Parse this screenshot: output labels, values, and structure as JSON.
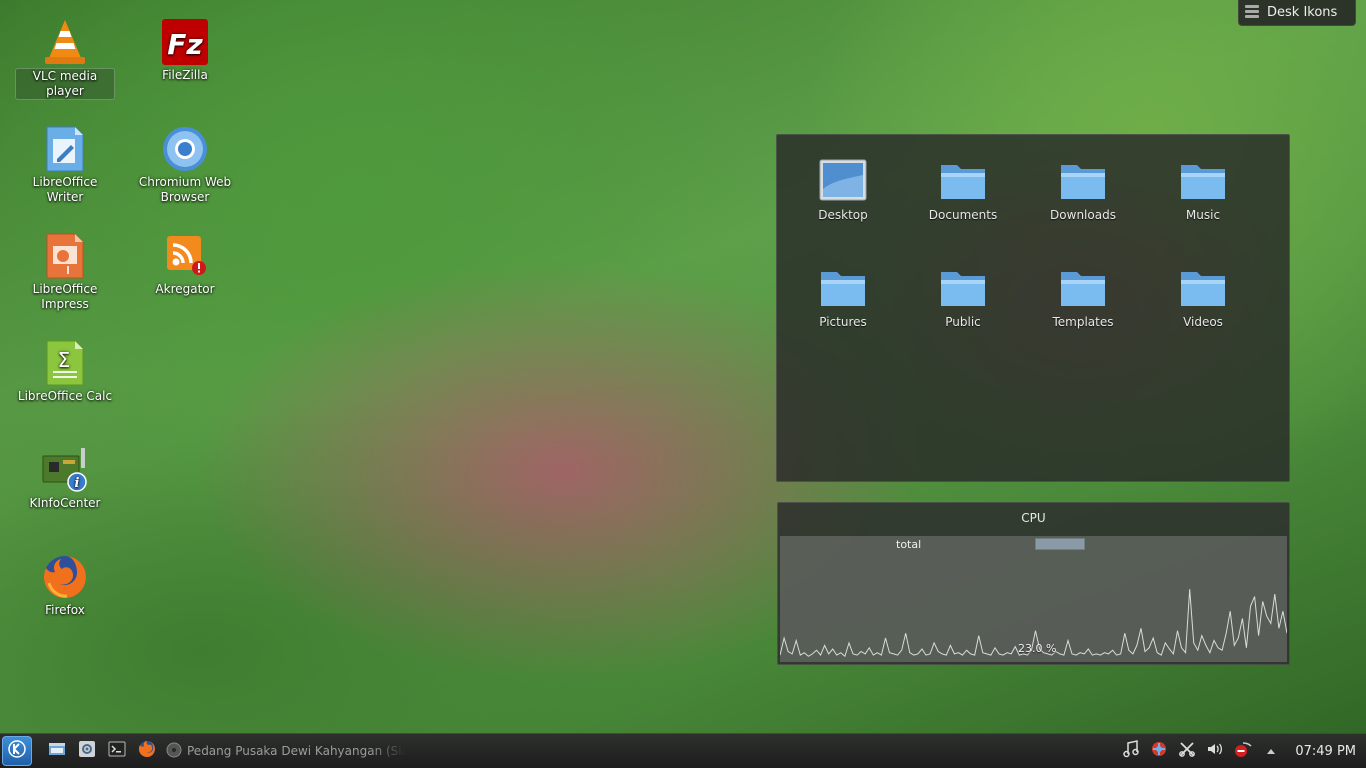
{
  "desktop_icons": [
    {
      "id": "vlc",
      "label": "VLC media player",
      "icon": "vlc-cone-icon"
    },
    {
      "id": "filezilla",
      "label": "FileZilla",
      "icon": "filezilla-icon"
    },
    {
      "id": "writer",
      "label": "LibreOffice Writer",
      "icon": "libreoffice-writer-icon"
    },
    {
      "id": "chromium",
      "label": "Chromium Web Browser",
      "icon": "chromium-icon"
    },
    {
      "id": "impress",
      "label": "LibreOffice Impress",
      "icon": "libreoffice-impress-icon"
    },
    {
      "id": "akregator",
      "label": "Akregator",
      "icon": "akregator-rss-icon"
    },
    {
      "id": "calc",
      "label": "LibreOffice Calc",
      "icon": "libreoffice-calc-icon"
    },
    {
      "id": "kinfocenter",
      "label": "KInfoCenter",
      "icon": "kinfocenter-icon"
    },
    {
      "id": "firefox",
      "label": "Firefox",
      "icon": "firefox-icon"
    }
  ],
  "folder_view": {
    "items": [
      {
        "label": "Desktop",
        "icon": "desktop-folder-icon"
      },
      {
        "label": "Documents",
        "icon": "folder-icon"
      },
      {
        "label": "Downloads",
        "icon": "folder-icon"
      },
      {
        "label": "Music",
        "icon": "folder-icon"
      },
      {
        "label": "Pictures",
        "icon": "folder-icon"
      },
      {
        "label": "Public",
        "icon": "folder-icon"
      },
      {
        "label": "Templates",
        "icon": "folder-icon"
      },
      {
        "label": "Videos",
        "icon": "folder-icon"
      }
    ]
  },
  "cpu_widget": {
    "title": "CPU",
    "legend_label": "total",
    "current_value": "23.0 %"
  },
  "chart_data": {
    "type": "line",
    "title": "CPU",
    "series": [
      {
        "name": "total",
        "values": [
          4,
          18,
          7,
          5,
          16,
          4,
          6,
          3,
          5,
          8,
          4,
          12,
          5,
          9,
          4,
          6,
          3,
          14,
          5,
          4,
          7,
          5,
          10,
          4,
          6,
          4,
          18,
          6,
          5,
          4,
          8,
          22,
          6,
          4,
          5,
          9,
          4,
          5,
          14,
          7,
          5,
          4,
          12,
          5,
          6,
          4,
          8,
          5,
          4,
          20,
          6,
          5,
          4,
          10,
          5,
          4,
          6,
          5,
          11,
          4,
          5,
          4,
          8,
          24,
          9,
          6,
          5,
          4,
          7,
          5,
          4,
          16,
          5,
          4,
          6,
          5,
          9,
          4,
          5,
          4,
          6,
          5,
          8,
          4,
          5,
          22,
          8,
          5,
          12,
          26,
          7,
          10,
          18,
          6,
          4,
          14,
          9,
          5,
          24,
          10,
          6,
          58,
          14,
          8,
          20,
          12,
          6,
          16,
          10,
          8,
          22,
          40,
          12,
          18,
          34,
          10,
          44,
          52,
          20,
          48,
          36,
          30,
          54,
          26,
          40,
          22
        ]
      }
    ],
    "ylim": [
      0,
      100
    ]
  },
  "desk_ikons_button": {
    "label": "Desk Ikons"
  },
  "taskbar": {
    "task_label": "Pedang Pusaka Dewi Kahyangan (Siauw...",
    "clock": "07:49 PM"
  },
  "colors": {
    "panel_bg": "#2a2c2a",
    "folder_blue": "#6fb3ea",
    "cpu_line": "#d0d4d0"
  }
}
